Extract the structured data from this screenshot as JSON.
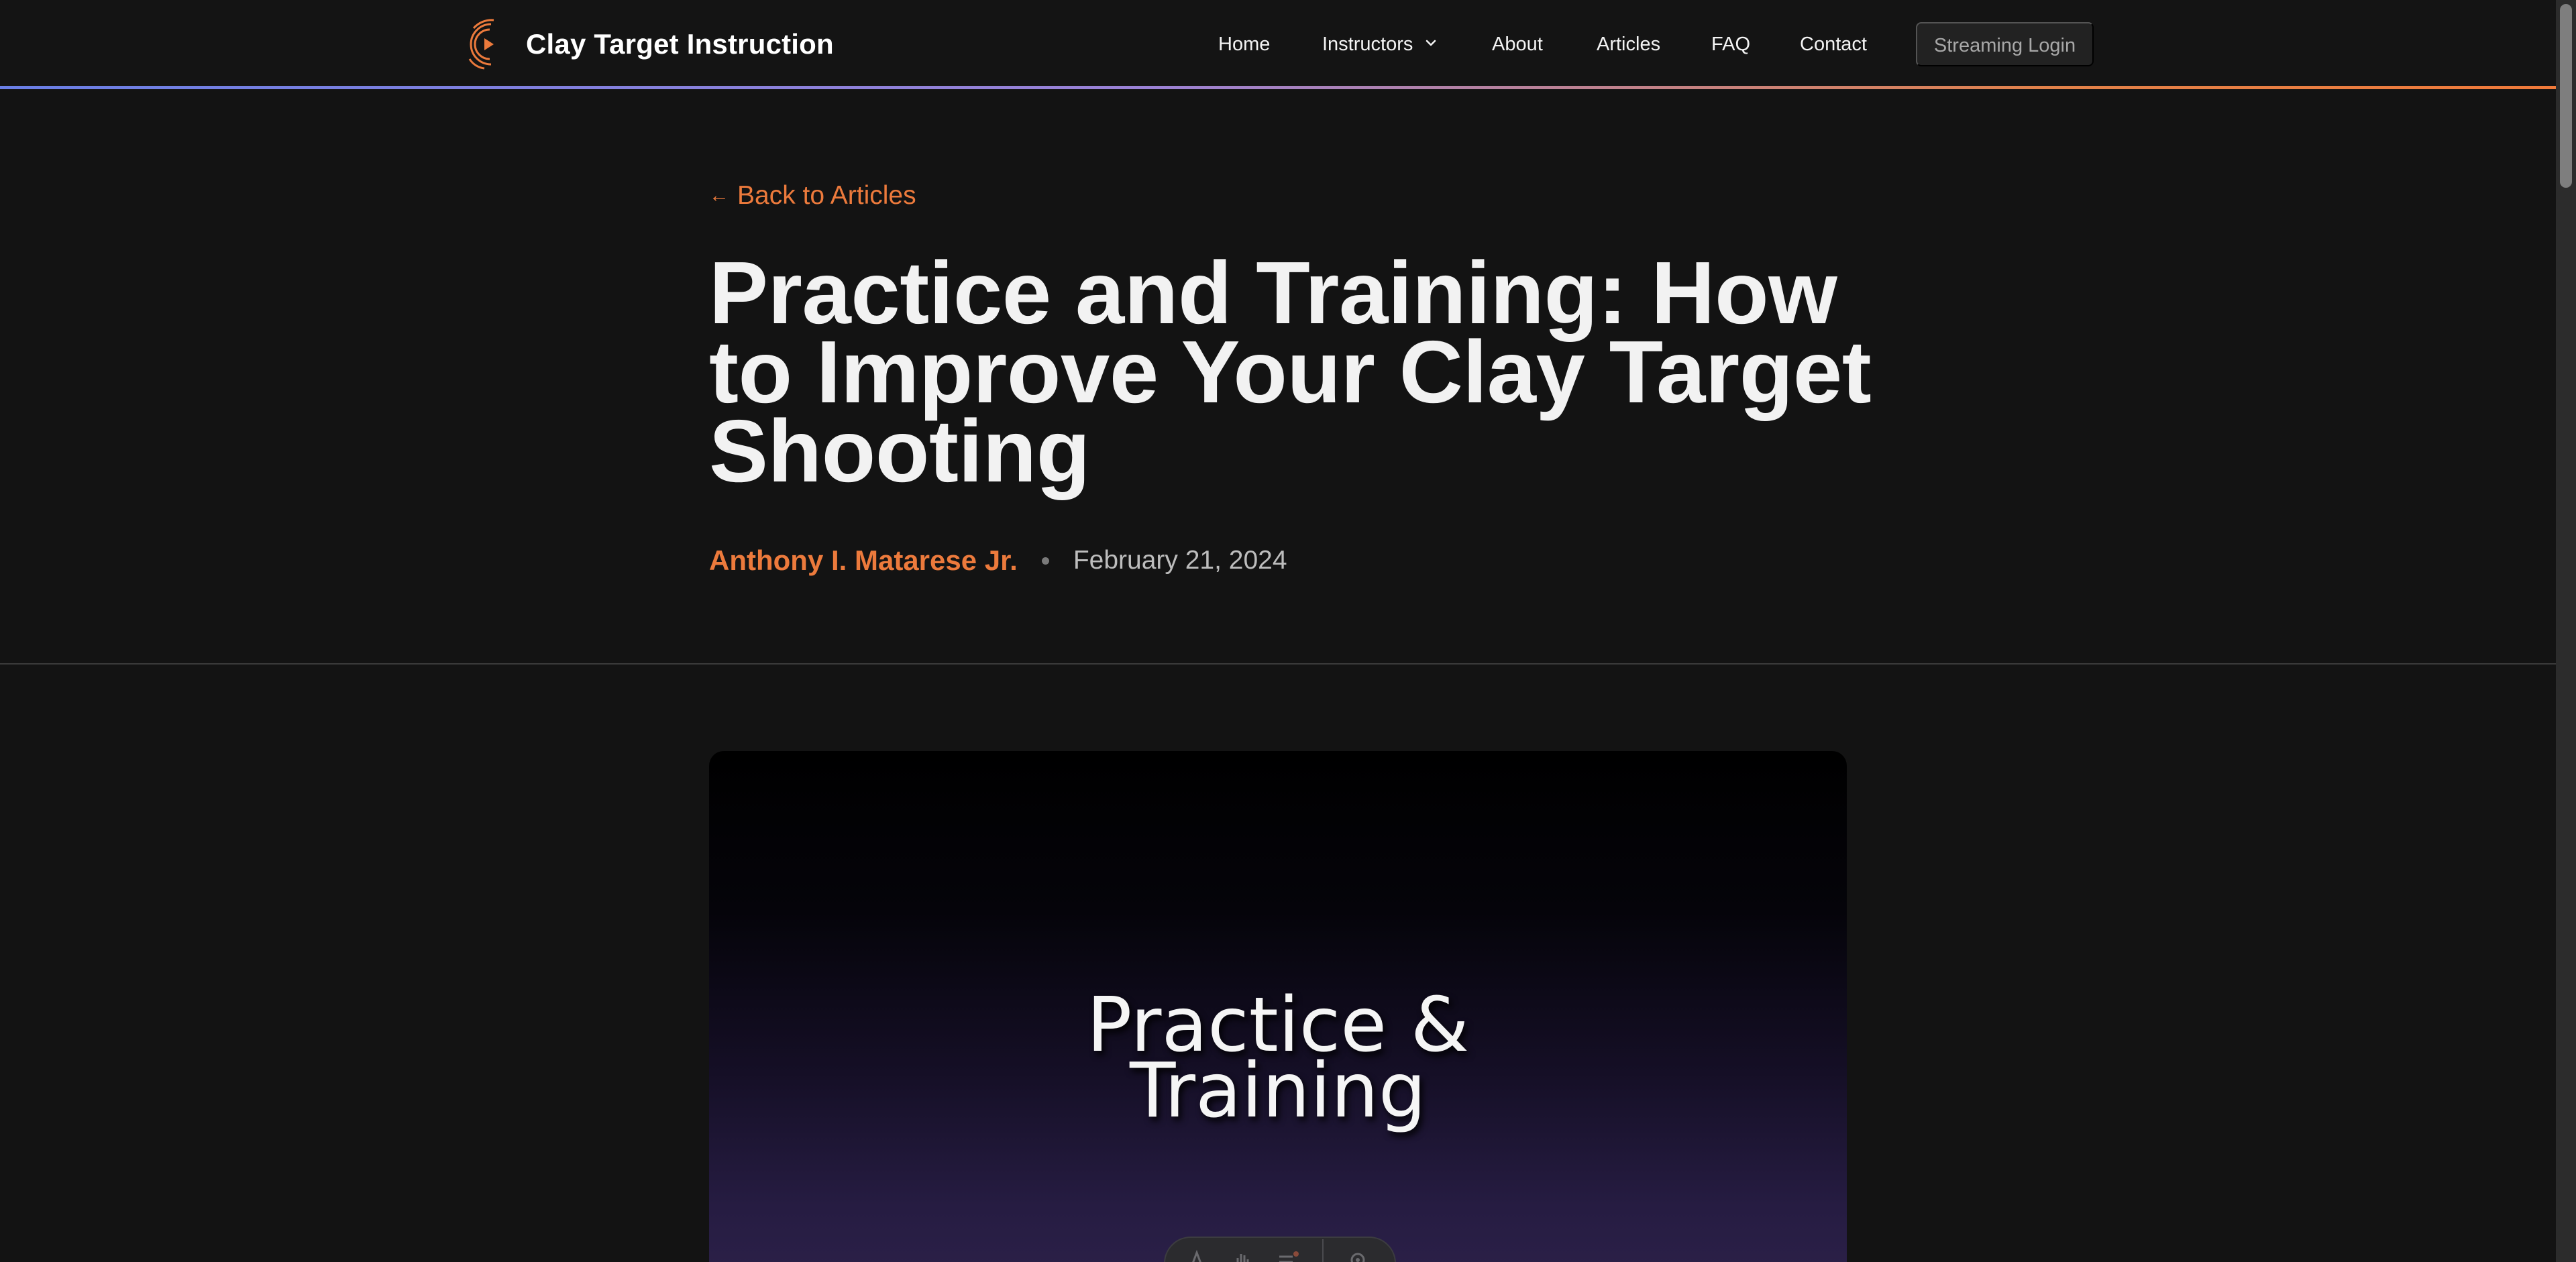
{
  "header": {
    "brand_name": "Clay Target Instruction",
    "nav": [
      {
        "label": "Home"
      },
      {
        "label": "Instructors",
        "has_dropdown": true
      },
      {
        "label": "About"
      },
      {
        "label": "Articles"
      },
      {
        "label": "FAQ"
      },
      {
        "label": "Contact"
      }
    ],
    "login_label": "Streaming Login"
  },
  "article": {
    "back_label": "Back to Articles",
    "title": "Practice and Training: How to Improve Your Clay Target Shooting",
    "author": "Anthony I. Matarese Jr.",
    "date": "February 21, 2024",
    "hero_line1": "Practice &",
    "hero_line2": "Training"
  },
  "colors": {
    "accent": "#ec7a3c",
    "background": "#131313",
    "header_gradient_start": "#6a7fe6",
    "header_gradient_end": "#f07a3a"
  }
}
